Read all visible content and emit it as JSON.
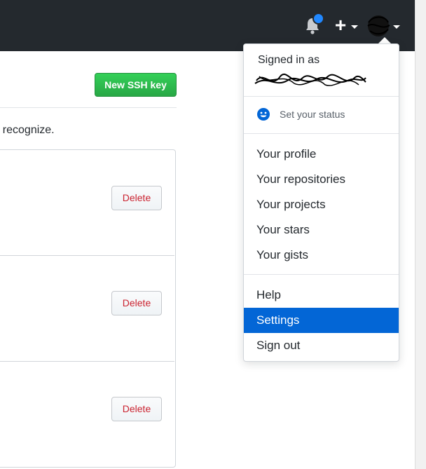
{
  "header": {
    "notifications_icon": "bell-icon",
    "create_icon": "plus-icon",
    "avatar_icon": "avatar-icon"
  },
  "content": {
    "new_key_label": "New SSH key",
    "note_text": "ot recognize.",
    "keys": [
      {
        "delete_label": "Delete"
      },
      {
        "delete_label": "Delete"
      },
      {
        "delete_label": "Delete"
      }
    ]
  },
  "dropdown": {
    "signed_in_label": "Signed in as",
    "status_label": "Set your status",
    "status_icon": "smiley-icon",
    "items": [
      {
        "label": "Your profile"
      },
      {
        "label": "Your repositories"
      },
      {
        "label": "Your projects"
      },
      {
        "label": "Your stars"
      },
      {
        "label": "Your gists"
      },
      {
        "label": "Help"
      },
      {
        "label": "Settings",
        "active": true
      },
      {
        "label": "Sign out"
      }
    ]
  },
  "colors": {
    "header_bg": "#24292e",
    "primary_green": "#28a745",
    "danger_red": "#cb2431",
    "active_blue": "#0366d6",
    "notification_dot": "#2188ff"
  }
}
